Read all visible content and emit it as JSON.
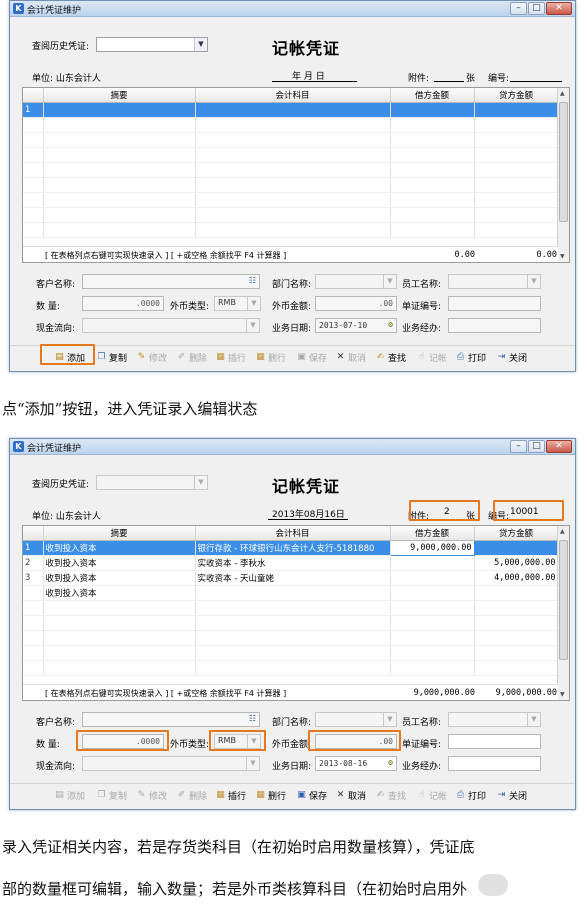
{
  "screen1": {
    "window_title": "会计凭证维护",
    "history_label": "查阅历史凭证:",
    "title": "记帐凭证",
    "unit_label": "单位: 山东会计人",
    "date_text": "年  月  日",
    "attach_label": "附件:",
    "attach_value": "",
    "attach_unit": "张",
    "no_label": "编号:",
    "no_value": "",
    "columns": [
      "摘要",
      "会计科目",
      "借方金额",
      "贷方金额"
    ],
    "rows": [
      {
        "idx": "1",
        "summary": "",
        "account": "",
        "debit": "",
        "credit": ""
      }
    ],
    "hint": "[ 在表格列点右键可实现快速录入 ] [ +或空格 余额找平  F4 计算器 ]",
    "total_debit": "0.00",
    "total_credit": "0.00",
    "customer_label": "客户名称:",
    "dept_label": "部门名称:",
    "employee_label": "员工名称:",
    "qty_label": "数    量:",
    "qty_value": ".0000",
    "currency_label": "外币类型:",
    "currency_value": "RMB",
    "fx_amount_label": "外币金额:",
    "fx_amount_value": ".00",
    "doc_no_label": "单证编号:",
    "cashflow_label": "现金流向:",
    "biz_date_label": "业务日期:",
    "biz_date_value": "2013-07-10",
    "handler_label": "业务经办:",
    "toolbar": [
      "添加",
      "复制",
      "修改",
      "删除",
      "插行",
      "删行",
      "保存",
      "取消",
      "查找",
      "记帐",
      "打印",
      "关闭"
    ]
  },
  "caption1": "点“添加”按钮，进入凭证录入编辑状态",
  "screen2": {
    "window_title": "会计凭证维护",
    "history_label": "查阅历史凭证:",
    "title": "记帐凭证",
    "unit_label": "单位: 山东会计人",
    "date_text": "2013年08月16日",
    "attach_label": "附件:",
    "attach_value": "2",
    "attach_unit": "张",
    "no_label": "编号:",
    "no_value": "10001",
    "columns": [
      "摘要",
      "会计科目",
      "借方金额",
      "贷方金额"
    ],
    "rows": [
      {
        "idx": "1",
        "summary": "收到投入资本",
        "account": "银行存款 - 环球银行山东会计人支行-5181880",
        "debit": "9,000,000.00",
        "credit": ""
      },
      {
        "idx": "2",
        "summary": "收到投入资本",
        "account": "实收资本 - 李秋水",
        "debit": "",
        "credit": "5,000,000.00"
      },
      {
        "idx": "3",
        "summary": "收到投入资本",
        "account": "实收资本 - 天山童姥",
        "debit": "",
        "credit": "4,000,000.00"
      },
      {
        "idx": "",
        "summary": "收到投入资本",
        "account": "",
        "debit": "",
        "credit": ""
      }
    ],
    "hint": "[ 在表格列点右键可实现快速录入 ] [ +或空格 余额找平  F4 计算器 ]",
    "total_debit": "9,000,000.00",
    "total_credit": "9,000,000.00",
    "customer_label": "客户名称:",
    "dept_label": "部门名称:",
    "employee_label": "员工名称:",
    "qty_label": "数    量:",
    "qty_value": ".0000",
    "currency_label": "外币类型:",
    "currency_value": "RMB",
    "fx_amount_label": "外币金额:",
    "fx_amount_value": ".00",
    "doc_no_label": "单证编号:",
    "cashflow_label": "现金流向:",
    "biz_date_label": "业务日期:",
    "biz_date_value": "2013-08-16",
    "handler_label": "业务经办:",
    "toolbar": [
      "添加",
      "复制",
      "修改",
      "删除",
      "插行",
      "删行",
      "保存",
      "取消",
      "查找",
      "记帐",
      "打印",
      "关闭"
    ]
  },
  "caption2": "录入凭证相关内容，若是存货类科目（在初始时启用数量核算），凭证底",
  "caption3": "部的数量框可编辑，输入数量；若是外币类核算科目（在初始时启用外"
}
